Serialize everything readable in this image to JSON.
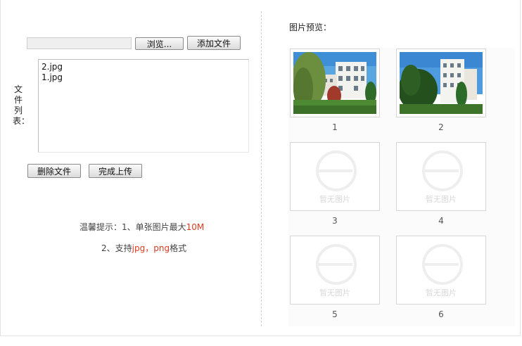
{
  "upload": {
    "browse_label": "浏览...",
    "add_label": "添加文件",
    "list_label": "文件列表：",
    "files": [
      "2.jpg",
      "1.jpg"
    ],
    "delete_label": "删除文件",
    "done_label": "完成上传"
  },
  "tips": {
    "line1_prefix": "温馨提示：1、单张图片最大",
    "line1_value": "10M",
    "line2_prefix": "2、支持",
    "line2_fmt1": "jpg",
    "line2_sep": "，",
    "line2_fmt2": "png",
    "line2_suffix": "格式"
  },
  "preview": {
    "title": "图片预览：",
    "placeholder_text": "暂无图片",
    "slots": [
      {
        "caption": "1",
        "has_image": true
      },
      {
        "caption": "2",
        "has_image": true
      },
      {
        "caption": "3",
        "has_image": false
      },
      {
        "caption": "4",
        "has_image": false
      },
      {
        "caption": "5",
        "has_image": false
      },
      {
        "caption": "6",
        "has_image": false
      }
    ]
  },
  "colors": {
    "highlight": "#e03a1e",
    "placeholder": "#eeeeee"
  }
}
